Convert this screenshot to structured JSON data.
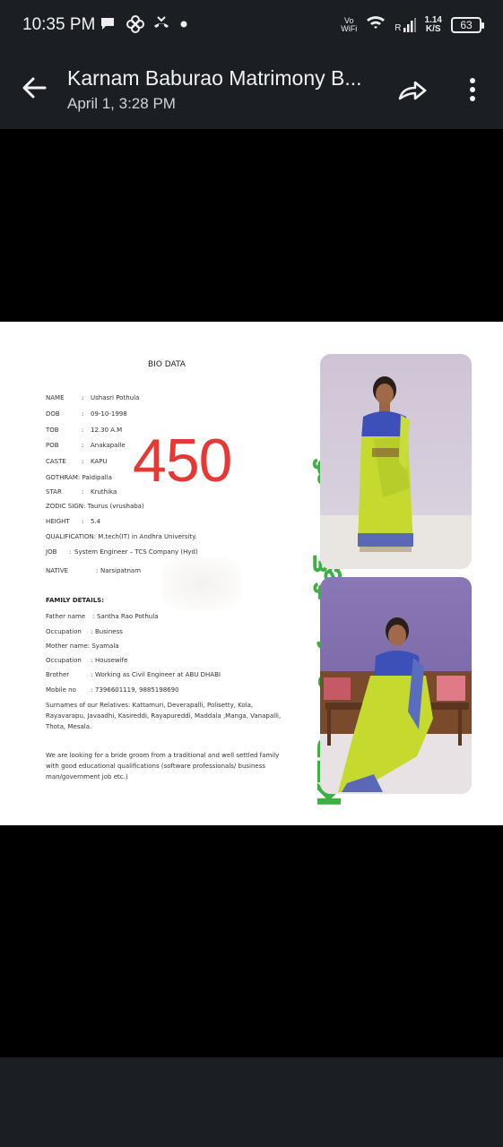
{
  "status_bar": {
    "time": "10:35 PM",
    "volte": "Vo",
    "wifi_label": "WiFi",
    "roaming": "R",
    "net_speed_value": "1.14",
    "net_speed_unit": "K/S",
    "battery": "63"
  },
  "app_bar": {
    "title": "Karnam Baburao Matrimony B...",
    "subtitle": "April 1, 3:28 PM"
  },
  "biodata": {
    "title": "BIO DATA",
    "rows": [
      {
        "label": "NAME",
        "sep": ":",
        "value": "Ushasri Pothula"
      },
      {
        "label": "DOB",
        "sep": ":",
        "value": "09-10-1998"
      },
      {
        "label": "TOB",
        "sep": ":",
        "value": "12.30 A.M"
      },
      {
        "label": "POB",
        "sep": ":",
        "value": "Anakapalle"
      },
      {
        "label": "CASTE",
        "sep": ":",
        "value": "KAPU"
      },
      {
        "label": "GOTHRAM:",
        "sep": "",
        "value": "Paidipalla"
      },
      {
        "label": "STAR",
        "sep": ":",
        "value": "Kruthika"
      },
      {
        "label": "ZODIC SIGN:",
        "sep": "",
        "value": "Taurus (vrushaba)"
      },
      {
        "label": "HEIGHT",
        "sep": ":",
        "value": "5.4"
      },
      {
        "label": "QUALIFICATION:",
        "sep": "",
        "value": "M.tech(IT) in Andhra University."
      },
      {
        "label": "JOB",
        "sep": ":",
        "value": "System Engineer – TCS Company (Hyd)"
      },
      {
        "label": "NATIVE",
        "sep": ":",
        "value": "Narsipatnam"
      }
    ],
    "family_heading": "FAMILY DETAILS:",
    "family_rows": [
      {
        "label": "Father name",
        "sep": ":",
        "value": "Santha Rao Pothula"
      },
      {
        "label": "Occupation",
        "sep": ":",
        "value": "Business"
      },
      {
        "label": "Mother name:",
        "sep": "",
        "value": "Syamala"
      },
      {
        "label": "Occupation",
        "sep": ":",
        "value": "Housewife"
      },
      {
        "label": "Brother",
        "sep": ":",
        "value": "Working as Civil Engineer at ABU DHABI"
      },
      {
        "label": "Mobile no",
        "sep": ":",
        "value": "7396601119, 9885198690"
      }
    ],
    "surnames_line1": "Surnames of our Relatives: Kattamuri, Deverapalli, Polisetty, Kola,",
    "surnames_line2": "Rayavarapu, Javaadhi, Kasireddi, Rayapureddi, Maddala ,Manga, Vanapalli,",
    "surnames_line3": "Thota, Mesala.",
    "looking_line1": "We are looking for a bride groom from a traditional and well settled family",
    "looking_line2": "with good educational qualifications (software professionals/ business",
    "looking_line3": "man/government job etc.)"
  },
  "profile_number": "450",
  "watermark": "KTB వారి మ్యారేజ్ బ్యూరో",
  "colors": {
    "bar_bg": "#1b1e23",
    "number_red": "#e53935",
    "watermark_green": "#3cb043"
  }
}
